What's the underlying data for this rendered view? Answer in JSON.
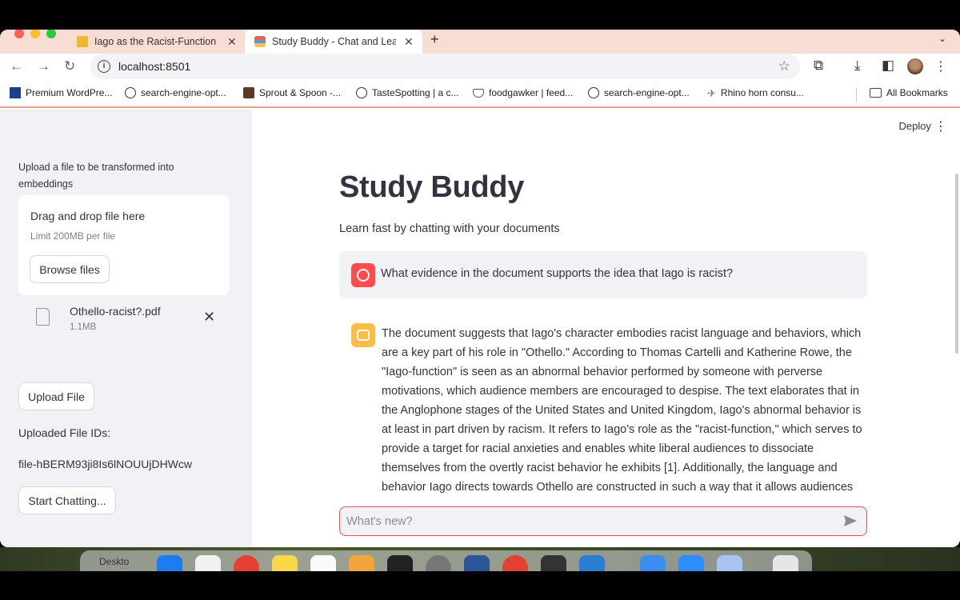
{
  "browser": {
    "tabs": [
      {
        "title": "Iago as the Racist-Function in",
        "close": "✕"
      },
      {
        "title": "Study Buddy - Chat and Lear",
        "close": "✕"
      }
    ],
    "new_tab": "+",
    "address": "localhost:8501",
    "bookmarks": [
      {
        "label": "Premium WordPre...",
        "icon": "wordpress-icon"
      },
      {
        "label": "search-engine-opt...",
        "icon": "globe-icon"
      },
      {
        "label": "Sprout & Spoon -...",
        "icon": "sprout-icon"
      },
      {
        "label": "TasteSpotting | a c...",
        "icon": "globe-icon"
      },
      {
        "label": "foodgawker | feed...",
        "icon": "cup-icon"
      },
      {
        "label": "search-engine-opt...",
        "icon": "globe-icon"
      },
      {
        "label": "Rhino horn consu...",
        "icon": "rhino-icon"
      }
    ],
    "all_bookmarks": "All Bookmarks"
  },
  "sidebar": {
    "upload_prompt": "Upload a file to be transformed into embeddings",
    "dropzone_title": "Drag and drop file here",
    "dropzone_limit": "Limit 200MB per file",
    "browse_button": "Browse files",
    "file_name": "Othello-racist?.pdf",
    "file_size": "1.1MB",
    "upload_button": "Upload File",
    "uploaded_ids_label": "Uploaded File IDs:",
    "file_id": "file-hBERM93ji8Is6lNOUUjDHWcw",
    "start_button": "Start Chatting..."
  },
  "main": {
    "deploy": "Deploy",
    "title": "Study Buddy",
    "subtitle": "Learn fast by chatting with your documents",
    "user_message": "What evidence in the document supports the idea that Iago is racist?",
    "assistant_message": "The document suggests that Iago's character embodies racist language and behaviors, which are a key part of his role in \"Othello.\" According to Thomas Cartelli and Katherine Rowe, the \"Iago-function\" is seen as an abnormal behavior performed by someone with perverse motivations, which audience members are encouraged to despise. The text elaborates that in the Anglophone stages of the United States and United Kingdom, Iago's abnormal behavior is at least in part driven by racism. It refers to Iago's role as the \"racist-function,\" which serves to provide a target for racial anxieties and enables white liberal audiences to dissociate themselves from the overtly racist behavior he exhibits [1]. Additionally, the language and behavior Iago directs towards Othello are constructed in such a way that it allows audiences to distance themselves from those",
    "chat_placeholder": "What's new?"
  },
  "dock": {
    "desktop_label": "Deskto"
  },
  "colors": {
    "accent": "#ff4b4b",
    "bot_avatar": "#ffbd45",
    "sidebar_bg": "#f0f2f6",
    "tab_strip": "#f7ddd3"
  }
}
